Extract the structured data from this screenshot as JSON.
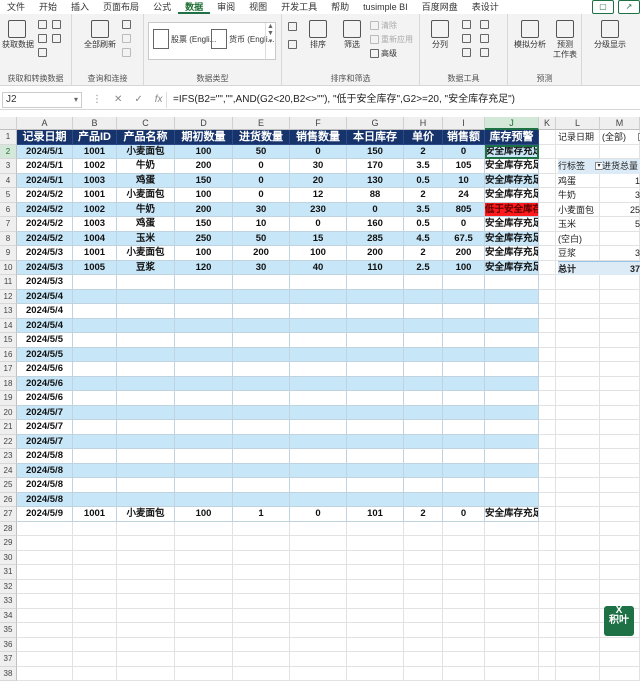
{
  "menu_tabs": [
    "文件",
    "开始",
    "插入",
    "页面布局",
    "公式",
    "数据",
    "审阅",
    "视图",
    "开发工具",
    "帮助",
    "tusimple BI",
    "百度网盘",
    "表设计"
  ],
  "active_tab_index": 5,
  "ribbon": {
    "get_data": "获取数据",
    "group_get_transform": "获取和转换数据",
    "refresh_all": "全部刷新",
    "group_queries": "查询和连接",
    "gallery_stocks": "股票 (Engli...",
    "gallery_currency": "货币 (Engli...",
    "group_data_types": "数据类型",
    "sort": "排序",
    "filter": "筛选",
    "clear": "清除",
    "reapply": "重新应用",
    "advanced": "高级",
    "group_sort_filter": "排序和筛选",
    "split": "分列",
    "group_data_tools": "数据工具",
    "what_if": "模拟分析",
    "forecast_sheet": "预测\n工作表",
    "group_forecast": "预测",
    "outline": "分级显示"
  },
  "formula_bar": {
    "name_box": "J2",
    "formula": "=IFS(B2=\"\",\"\",AND(G2<20,B2<>\"\"), \"低于安全库存\",G2>=20, \"安全库存充足\")"
  },
  "columns": [
    "A",
    "B",
    "C",
    "D",
    "E",
    "F",
    "G",
    "H",
    "I",
    "J",
    "K",
    "L",
    "M"
  ],
  "table": {
    "headers": [
      "记录日期",
      "产品ID",
      "产品名称",
      "期初数量",
      "进货数量",
      "销售数量",
      "本日库存",
      "单价",
      "销售额",
      "库存预警"
    ],
    "rows": [
      [
        "2024/5/1",
        "1001",
        "小麦面包",
        "100",
        "50",
        "0",
        "150",
        "2",
        "0",
        "安全库存充足"
      ],
      [
        "2024/5/1",
        "1002",
        "牛奶",
        "200",
        "0",
        "30",
        "170",
        "3.5",
        "105",
        "安全库存充足"
      ],
      [
        "2024/5/1",
        "1003",
        "鸡蛋",
        "150",
        "0",
        "20",
        "130",
        "0.5",
        "10",
        "安全库存充足"
      ],
      [
        "2024/5/2",
        "1001",
        "小麦面包",
        "100",
        "0",
        "12",
        "88",
        "2",
        "24",
        "安全库存充足"
      ],
      [
        "2024/5/2",
        "1002",
        "牛奶",
        "200",
        "30",
        "230",
        "0",
        "3.5",
        "805",
        "低于安全库存"
      ],
      [
        "2024/5/2",
        "1003",
        "鸡蛋",
        "150",
        "10",
        "0",
        "160",
        "0.5",
        "0",
        "安全库存充足"
      ],
      [
        "2024/5/2",
        "1004",
        "玉米",
        "250",
        "50",
        "15",
        "285",
        "4.5",
        "67.5",
        "安全库存充足"
      ],
      [
        "2024/5/3",
        "1001",
        "小麦面包",
        "100",
        "200",
        "100",
        "200",
        "2",
        "200",
        "安全库存充足"
      ],
      [
        "2024/5/3",
        "1005",
        "豆浆",
        "120",
        "30",
        "40",
        "110",
        "2.5",
        "100",
        "安全库存充足"
      ],
      [
        "2024/5/3",
        "",
        "",
        "",
        "",
        "",
        "",
        "",
        "",
        ""
      ],
      [
        "2024/5/4",
        "",
        "",
        "",
        "",
        "",
        "",
        "",
        "",
        ""
      ],
      [
        "2024/5/4",
        "",
        "",
        "",
        "",
        "",
        "",
        "",
        "",
        ""
      ],
      [
        "2024/5/4",
        "",
        "",
        "",
        "",
        "",
        "",
        "",
        "",
        ""
      ],
      [
        "2024/5/5",
        "",
        "",
        "",
        "",
        "",
        "",
        "",
        "",
        ""
      ],
      [
        "2024/5/5",
        "",
        "",
        "",
        "",
        "",
        "",
        "",
        "",
        ""
      ],
      [
        "2024/5/6",
        "",
        "",
        "",
        "",
        "",
        "",
        "",
        "",
        ""
      ],
      [
        "2024/5/6",
        "",
        "",
        "",
        "",
        "",
        "",
        "",
        "",
        ""
      ],
      [
        "2024/5/6",
        "",
        "",
        "",
        "",
        "",
        "",
        "",
        "",
        ""
      ],
      [
        "2024/5/7",
        "",
        "",
        "",
        "",
        "",
        "",
        "",
        "",
        ""
      ],
      [
        "2024/5/7",
        "",
        "",
        "",
        "",
        "",
        "",
        "",
        "",
        ""
      ],
      [
        "2024/5/7",
        "",
        "",
        "",
        "",
        "",
        "",
        "",
        "",
        ""
      ],
      [
        "2024/5/8",
        "",
        "",
        "",
        "",
        "",
        "",
        "",
        "",
        ""
      ],
      [
        "2024/5/8",
        "",
        "",
        "",
        "",
        "",
        "",
        "",
        "",
        ""
      ],
      [
        "2024/5/8",
        "",
        "",
        "",
        "",
        "",
        "",
        "",
        "",
        ""
      ],
      [
        "2024/5/8",
        "",
        "",
        "",
        "",
        "",
        "",
        "",
        "",
        ""
      ],
      [
        "2024/5/9",
        "1001",
        "小麦面包",
        "100",
        "1",
        "0",
        "101",
        "2",
        "0",
        "安全库存充足"
      ]
    ],
    "alert_row_index": 4
  },
  "pivot": {
    "filter_label": "记录日期",
    "filter_value": "(全部)",
    "row_label": "行标签",
    "value_header": "进货总量",
    "items": [
      {
        "label": "鸡蛋",
        "value": "1"
      },
      {
        "label": "牛奶",
        "value": "3"
      },
      {
        "label": "小麦面包",
        "value": "25"
      },
      {
        "label": "玉米",
        "value": "5"
      },
      {
        "label": "(空白)",
        "value": ""
      },
      {
        "label": "豆浆",
        "value": "3"
      }
    ],
    "total_label": "总计",
    "total_value": "37"
  },
  "extra_row_numbers": [
    "28",
    "29",
    "30",
    "31",
    "32",
    "33",
    "34",
    "35",
    "36",
    "37",
    "38"
  ],
  "logo": {
    "line1": "X",
    "line2": "积叶"
  },
  "colors": {
    "header_bg": "#17336b",
    "band_blue": "#c7e6f7",
    "alert_red": "#ff1b1b",
    "excel_green": "#1e7145"
  }
}
